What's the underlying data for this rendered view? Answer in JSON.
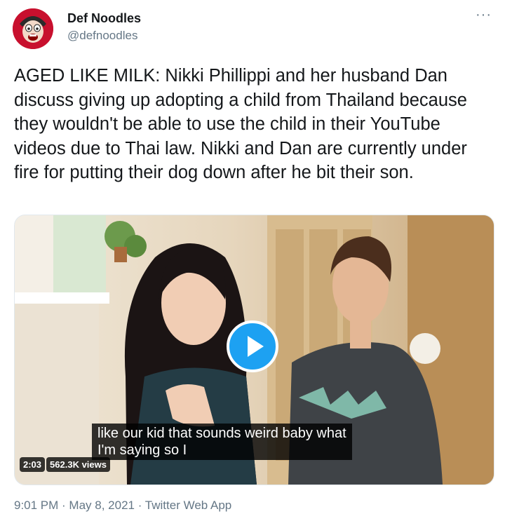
{
  "author": {
    "name": "Def Noodles",
    "handle": "@defnoodles"
  },
  "menu": {
    "more_icon": "more-horizontal-icon",
    "glyph": "···"
  },
  "tweet": {
    "text": "AGED LIKE MILK: Nikki Phillippi and her husband Dan discuss giving up adopting a child from Thailand because they wouldn't be able to use the child in their YouTube videos due to Thai law. Nikki and Dan are currently under fire for putting their dog down after he bit their son."
  },
  "video": {
    "subtitle_line1": "like our kid that sounds weird baby what",
    "subtitle_line2": "I'm saying so I",
    "duration": "2:03",
    "views": "562.3K views",
    "play_icon": "play-icon"
  },
  "meta": {
    "time": "9:01 PM",
    "sep1": " · ",
    "date": "May 8, 2021",
    "sep2": " · ",
    "source": "Twitter Web App"
  },
  "colors": {
    "accent": "#1da1f2",
    "muted": "#657786",
    "text": "#14171a",
    "avatar_bg": "#c8102e"
  }
}
